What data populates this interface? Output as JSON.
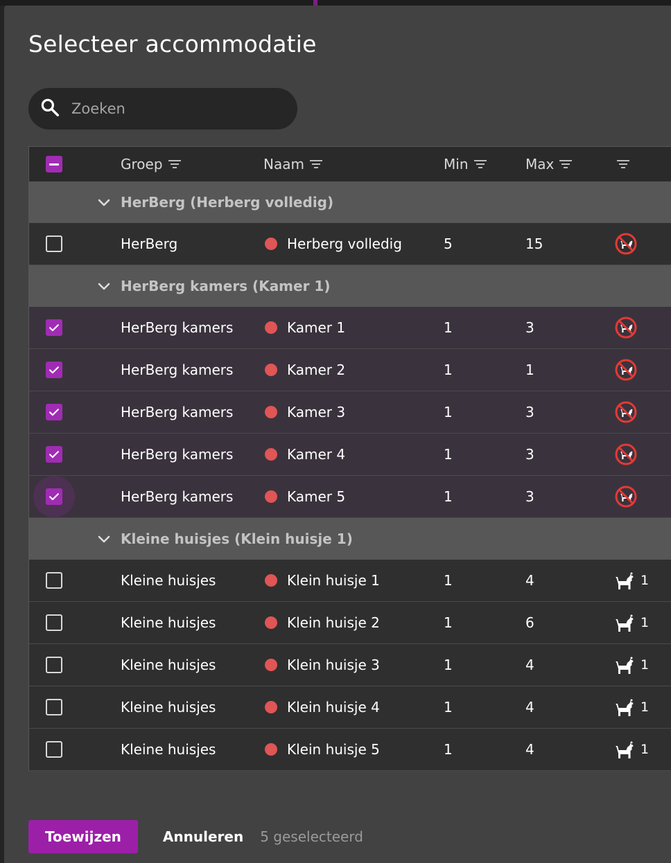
{
  "dialog": {
    "title": "Selecteer accommodatie",
    "search_placeholder": "Zoeken"
  },
  "table": {
    "headers": {
      "groep": "Groep",
      "naam": "Naam",
      "min": "Min",
      "max": "Max"
    },
    "groups": [
      {
        "label": "HerBerg (Herberg volledig)",
        "rows": [
          {
            "checked": false,
            "groep": "HerBerg",
            "naam": "Herberg volledig",
            "min": "5",
            "max": "15",
            "pets": "no-pets-icon",
            "pet_count": ""
          }
        ]
      },
      {
        "label": "HerBerg kamers (Kamer 1)",
        "rows": [
          {
            "checked": true,
            "groep": "HerBerg kamers",
            "naam": "Kamer 1",
            "min": "1",
            "max": "3",
            "pets": "no-pets-icon",
            "pet_count": ""
          },
          {
            "checked": true,
            "groep": "HerBerg kamers",
            "naam": "Kamer 2",
            "min": "1",
            "max": "1",
            "pets": "no-pets-icon",
            "pet_count": ""
          },
          {
            "checked": true,
            "groep": "HerBerg kamers",
            "naam": "Kamer 3",
            "min": "1",
            "max": "3",
            "pets": "no-pets-icon",
            "pet_count": ""
          },
          {
            "checked": true,
            "groep": "HerBerg kamers",
            "naam": "Kamer 4",
            "min": "1",
            "max": "3",
            "pets": "no-pets-icon",
            "pet_count": ""
          },
          {
            "checked": true,
            "groep": "HerBerg kamers",
            "naam": "Kamer 5",
            "min": "1",
            "max": "3",
            "pets": "no-pets-icon",
            "pet_count": ""
          }
        ]
      },
      {
        "label": "Kleine huisjes (Klein huisje 1)",
        "rows": [
          {
            "checked": false,
            "groep": "Kleine huisjes",
            "naam": "Klein huisje 1",
            "min": "1",
            "max": "4",
            "pets": "dog-icon",
            "pet_count": "1"
          },
          {
            "checked": false,
            "groep": "Kleine huisjes",
            "naam": "Klein huisje 2",
            "min": "1",
            "max": "6",
            "pets": "dog-icon",
            "pet_count": "1"
          },
          {
            "checked": false,
            "groep": "Kleine huisjes",
            "naam": "Klein huisje 3",
            "min": "1",
            "max": "4",
            "pets": "dog-icon",
            "pet_count": "1"
          },
          {
            "checked": false,
            "groep": "Kleine huisjes",
            "naam": "Klein huisje 4",
            "min": "1",
            "max": "4",
            "pets": "dog-icon",
            "pet_count": "1"
          },
          {
            "checked": false,
            "groep": "Kleine huisjes",
            "naam": "Klein huisje 5",
            "min": "1",
            "max": "4",
            "pets": "dog-icon",
            "pet_count": "1"
          }
        ]
      }
    ]
  },
  "footer": {
    "assign_label": "Toewijzen",
    "cancel_label": "Annuleren",
    "selected_count": "5 geselecteerd"
  },
  "colors": {
    "accent": "#a02cb4",
    "status_dot": "#e05555",
    "no_pets": "#e53935"
  }
}
